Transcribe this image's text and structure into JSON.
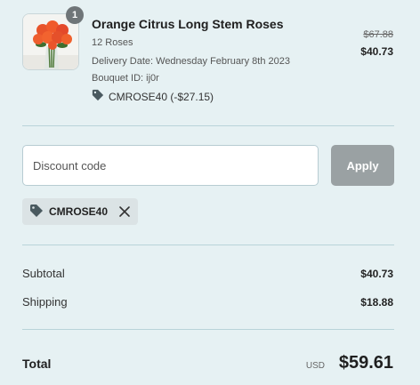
{
  "product": {
    "title": "Orange Citrus Long Stem Roses",
    "variant": "12 Roses",
    "delivery": "Delivery Date: Wednesday February 8th 2023",
    "bouquet_id": "Bouquet ID: ij0r",
    "discount_applied": "CMROSE40 (-$27.15)",
    "original_price": "$67.88",
    "price": "$40.73",
    "quantity": "1",
    "image_icon": "roses-bouquet-image"
  },
  "discount": {
    "placeholder": "Discount code",
    "value": "",
    "apply_label": "Apply",
    "chip_code": "CMROSE40",
    "remove_icon": "close-icon",
    "tag_icon": "tag-icon"
  },
  "summary": {
    "subtotal_label": "Subtotal",
    "subtotal_value": "$40.73",
    "shipping_label": "Shipping",
    "shipping_value": "$18.88",
    "total_label": "Total",
    "currency": "USD",
    "total_value": "$59.61"
  },
  "colors": {
    "background": "#e6f1f3",
    "divider": "#b9d4d9",
    "apply_button": "#9aa1a3",
    "chip": "#dbe3e5",
    "badge": "#6f7578"
  }
}
